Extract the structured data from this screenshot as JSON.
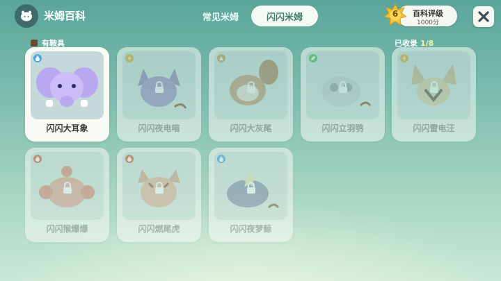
{
  "header": {
    "app_title": "米姆百科",
    "tabs": [
      {
        "label": "常见米姆",
        "active": false
      },
      {
        "label": "闪闪米姆",
        "active": true
      }
    ],
    "rating": {
      "level": "6",
      "title": "百科评级",
      "score": "1000分"
    },
    "close_icon": "close-icon"
  },
  "subheader": {
    "legend_label": "有鞍具",
    "collected_label": "已收录",
    "collected_count": "1/8"
  },
  "cards": [
    {
      "name": "闪闪大耳象",
      "type": "water",
      "locked": false,
      "owned": true
    },
    {
      "name": "闪闪夜电喵",
      "type": "electric",
      "locked": true,
      "owned": false
    },
    {
      "name": "闪闪大灰尾",
      "type": "grass",
      "locked": true,
      "owned": false
    },
    {
      "name": "闪闪立羽鸮",
      "type": "leaf",
      "locked": true,
      "owned": false
    },
    {
      "name": "闪闪雷电汪",
      "type": "electric",
      "locked": true,
      "owned": false
    },
    {
      "name": "闪闪猴爆爆",
      "type": "fire",
      "locked": true,
      "owned": false
    },
    {
      "name": "闪闪燃尾虎",
      "type": "fire",
      "locked": true,
      "owned": false
    },
    {
      "name": "闪闪夜梦鲸",
      "type": "water",
      "locked": true,
      "owned": false
    }
  ],
  "colors": {
    "water": "#4aa7e8",
    "electric": "#e6b33a",
    "grass": "#d9a45a",
    "leaf": "#5fbf63",
    "fire": "#e55a3f"
  }
}
